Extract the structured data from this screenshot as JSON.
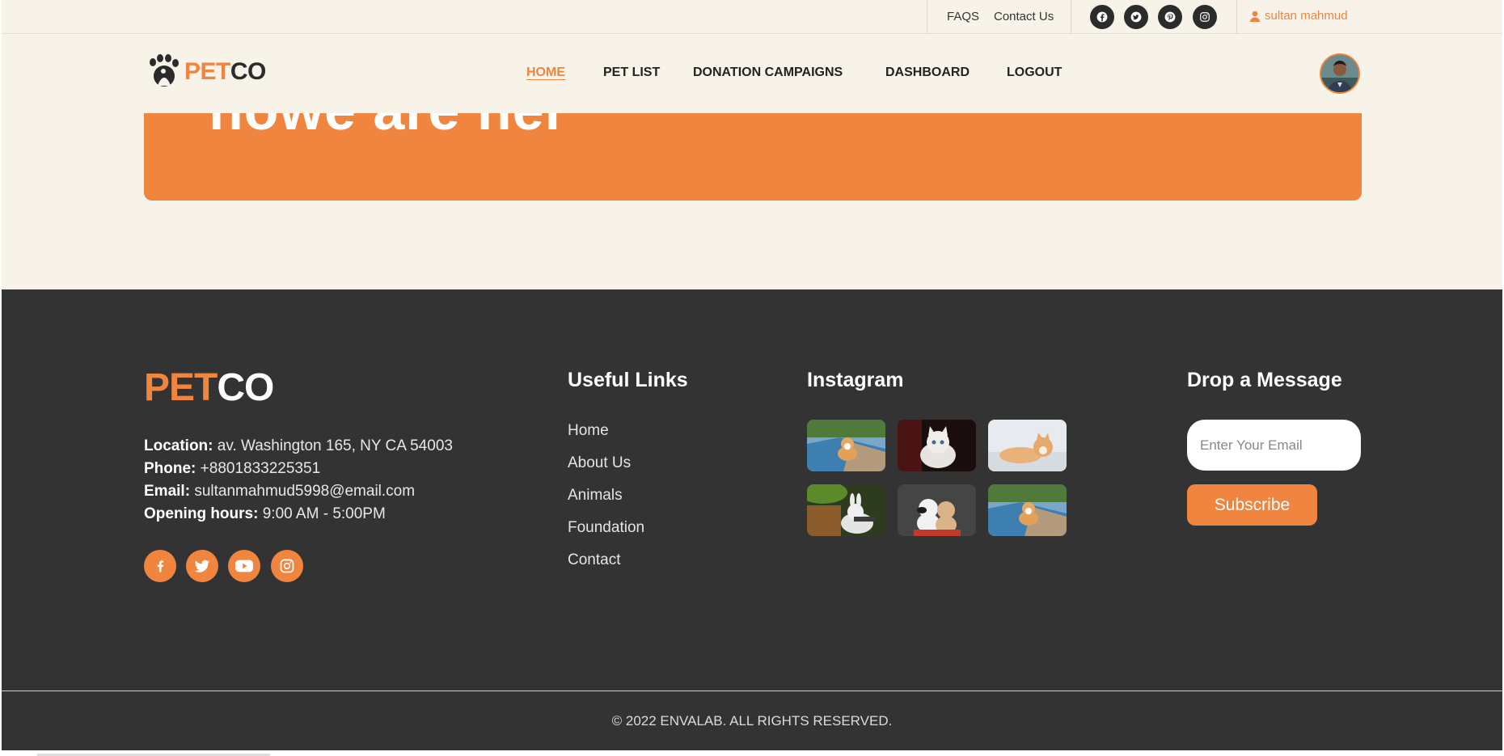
{
  "topbar": {
    "links": [
      "FAQS",
      "Contact Us"
    ],
    "social_icons": [
      "facebook-icon",
      "twitter-icon",
      "pinterest-icon",
      "instagram-icon"
    ],
    "user_name": "sultan mahmud"
  },
  "nav": {
    "logo": {
      "pet": "PET",
      "co": "CO"
    },
    "items": [
      {
        "label": "HOME",
        "active": true
      },
      {
        "label": "PET LIST",
        "active": false
      },
      {
        "label": "DONATION CAMPAIGNS",
        "active": false
      },
      {
        "label": "DASHBOARD",
        "active": false
      },
      {
        "label": "LOGOUT",
        "active": false
      }
    ]
  },
  "banner": {
    "partial_text": "nowe are ner"
  },
  "footer": {
    "logo": {
      "pet": "PET",
      "co": "CO"
    },
    "info": [
      {
        "label": "Location:",
        "value": "av. Washington 165, NY CA 54003"
      },
      {
        "label": "Phone:",
        "value": "+8801833225351"
      },
      {
        "label": "Email:",
        "value": "sultanmahmud5998@email.com"
      },
      {
        "label": "Opening hours:",
        "value": "9:00 AM - 5:00PM"
      }
    ],
    "social_icons": [
      "facebook-icon",
      "twitter-icon",
      "youtube-icon",
      "instagram-icon"
    ],
    "useful_links": {
      "heading": "Useful Links",
      "items": [
        "Home",
        "About Us",
        "Animals",
        "Foundation",
        "Contact"
      ]
    },
    "instagram": {
      "heading": "Instagram",
      "images": [
        "corgi-photo",
        "kitten-photo",
        "shiba-photo",
        "rabbit-photo",
        "puppies-photo",
        "corgi-photo-2"
      ]
    },
    "message": {
      "heading": "Drop a Message",
      "email_placeholder": "Enter Your Email",
      "subscribe_label": "Subscribe"
    },
    "copyright": "© 2022 ENVALAB. ALL RIGHTS RESERVED."
  },
  "colors": {
    "accent": "#f08540",
    "page_bg": "#f8f3e8",
    "footer_bg": "#333333",
    "dark_icon": "#2b2b2b"
  }
}
